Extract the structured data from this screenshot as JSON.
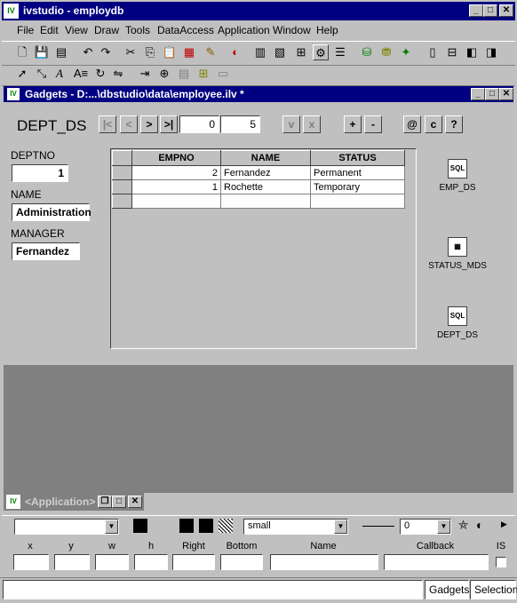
{
  "app": {
    "title": "ivstudio - employdb",
    "logo": "IV"
  },
  "menu": [
    "File",
    "Edit",
    "View",
    "Draw",
    "Tools",
    "DataAccess",
    "Application",
    "Window",
    "Help"
  ],
  "gadgets_window": {
    "title": "Gadgets - D:...\\dbstudio\\data\\employee.ilv *",
    "navigator": {
      "name": "DEPT_DS",
      "first": "|<",
      "prev": "<",
      "next": ">",
      "last": ">|",
      "position": "0",
      "count": "5",
      "validate": "v",
      "cancel": "x",
      "insert": "+",
      "delete": "-",
      "query": "@",
      "clear": "c",
      "help": "?"
    },
    "form": {
      "deptno_label": "DEPTNO",
      "deptno_value": "1",
      "name_label": "NAME",
      "name_value": "Administration",
      "manager_label": "MANAGER",
      "manager_value": "Fernandez"
    },
    "table": {
      "columns": [
        "EMPNO",
        "NAME",
        "STATUS"
      ],
      "rows": [
        {
          "empno": "2",
          "name": "Fernandez",
          "status": "Permanent"
        },
        {
          "empno": "1",
          "name": "Rochette",
          "status": "Temporary"
        }
      ]
    },
    "data_sources": [
      {
        "label": "EMP_DS",
        "icon": "sql-icon"
      },
      {
        "label": "STATUS_MDS",
        "icon": "table-icon"
      },
      {
        "label": "DEPT_DS",
        "icon": "sql-icon"
      }
    ]
  },
  "application_window": {
    "title": "<Application>"
  },
  "inspector": {
    "font_size": "small",
    "line_width": "0",
    "labels": {
      "x": "x",
      "y": "y",
      "w": "w",
      "h": "h",
      "right": "Right",
      "bottom": "Bottom",
      "name": "Name",
      "callback": "Callback",
      "is": "IS"
    }
  },
  "statusbar": {
    "buffer": "Gadgets",
    "mode": "Selection"
  }
}
